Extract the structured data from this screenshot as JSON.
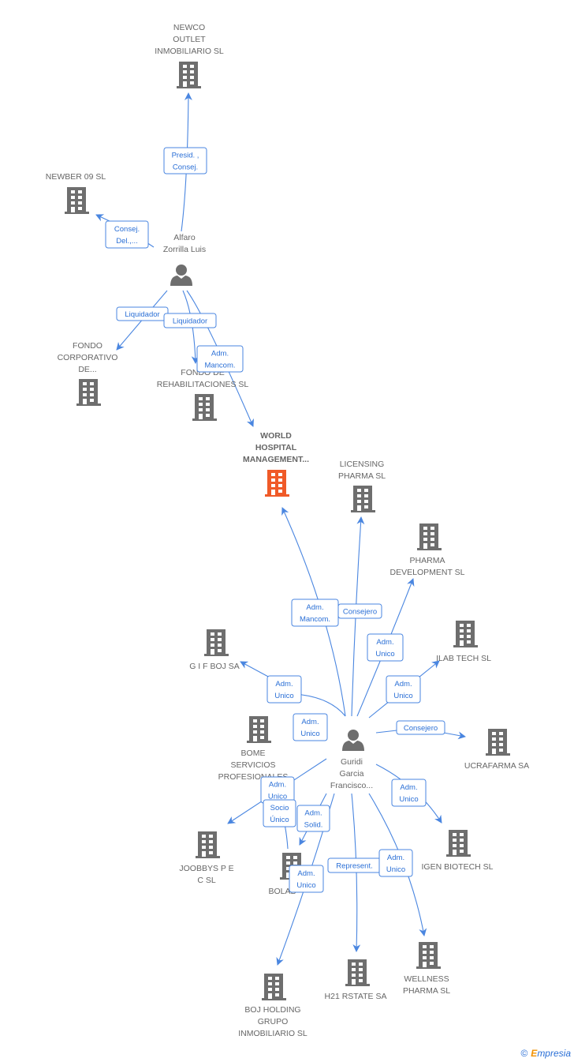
{
  "colors": {
    "edge": "#4a86e0",
    "company": "#6e6e6e",
    "focus_company": "#f05a28",
    "person": "#6e6e6e"
  },
  "nodes": [
    {
      "id": "newco",
      "type": "company",
      "lines": [
        "NEWCO",
        "OUTLET",
        "INMOBILIARIO SL"
      ]
    },
    {
      "id": "newber",
      "type": "company",
      "lines": [
        "NEWBER 09 SL"
      ]
    },
    {
      "id": "alfaro",
      "type": "person",
      "lines": [
        "Alfaro",
        "Zorrilla Luis"
      ]
    },
    {
      "id": "fondo_corp",
      "type": "company",
      "lines": [
        "FONDO",
        "CORPORATIVO",
        "DE..."
      ]
    },
    {
      "id": "fondo_rehab",
      "type": "company",
      "lines": [
        "FONDO DE",
        "REHABILITACIONES SL"
      ]
    },
    {
      "id": "world",
      "type": "focus",
      "lines": [
        "WORLD",
        "HOSPITAL",
        "MANAGEMENT..."
      ]
    },
    {
      "id": "licensing",
      "type": "company",
      "lines": [
        "LICENSING",
        "PHARMA SL"
      ]
    },
    {
      "id": "pharma_dev",
      "type": "company",
      "lines": [
        "PHARMA",
        "DEVELOPMENT SL"
      ]
    },
    {
      "id": "ilab",
      "type": "company",
      "lines": [
        "ILAB TECH SL"
      ]
    },
    {
      "id": "gif",
      "type": "company",
      "lines": [
        "G I F BOJ SA"
      ]
    },
    {
      "id": "ucrafarma",
      "type": "company",
      "lines": [
        "UCRAFARMA SA"
      ]
    },
    {
      "id": "guridi",
      "type": "person",
      "lines": [
        "Guridi",
        "Garcia",
        "Francisco..."
      ]
    },
    {
      "id": "bome",
      "type": "company",
      "lines": [
        "BOME",
        "SERVICIOS",
        "PROFESIONALES"
      ]
    },
    {
      "id": "joobbys",
      "type": "company",
      "lines": [
        "JOOBBYS P E",
        "C SL"
      ]
    },
    {
      "id": "bolab",
      "type": "company",
      "lines": [
        "BOLAB"
      ]
    },
    {
      "id": "igen",
      "type": "company",
      "lines": [
        "IGEN BIOTECH SL"
      ]
    },
    {
      "id": "h21",
      "type": "company",
      "lines": [
        "H21 RSTATE SA"
      ]
    },
    {
      "id": "wellness",
      "type": "company",
      "lines": [
        "WELLNESS",
        "PHARMA SL"
      ]
    },
    {
      "id": "boj_holding",
      "type": "company",
      "lines": [
        "BOJ HOLDING",
        "GRUPO",
        "INMOBILIARIO SL"
      ]
    }
  ],
  "edges": [
    {
      "from": "alfaro",
      "to": "newco",
      "label": [
        "Presid. ,",
        "Consej."
      ]
    },
    {
      "from": "alfaro",
      "to": "newber",
      "label": [
        "Consej.",
        "Del.,..."
      ]
    },
    {
      "from": "alfaro",
      "to": "fondo_corp",
      "label": [
        "Liquidador"
      ]
    },
    {
      "from": "alfaro",
      "to": "fondo_rehab",
      "label": [
        "Liquidador"
      ]
    },
    {
      "from": "alfaro",
      "to": "world",
      "label": [
        "Adm.",
        "Mancom."
      ]
    },
    {
      "from": "guridi",
      "to": "world",
      "label": [
        "Adm.",
        "Mancom."
      ]
    },
    {
      "from": "guridi",
      "to": "licensing",
      "label": [
        "Consejero"
      ]
    },
    {
      "from": "guridi",
      "to": "pharma_dev",
      "label": [
        "Adm.",
        "Unico"
      ]
    },
    {
      "from": "guridi",
      "to": "ilab",
      "label": [
        "Adm.",
        "Unico"
      ]
    },
    {
      "from": "guridi",
      "to": "gif",
      "label": [
        "Adm.",
        "Unico"
      ]
    },
    {
      "from": "guridi",
      "to": "bome",
      "label": [
        "Adm.",
        "Unico"
      ]
    },
    {
      "from": "guridi",
      "to": "ucrafarma",
      "label": [
        "Consejero"
      ]
    },
    {
      "from": "guridi",
      "to": "igen",
      "label": [
        "Adm.",
        "Unico"
      ]
    },
    {
      "from": "guridi",
      "to": "joobbys",
      "label": [
        "Adm.",
        "Unico"
      ]
    },
    {
      "from": "guridi",
      "to": "bome",
      "label": [
        "Socio",
        "Único"
      ]
    },
    {
      "from": "guridi",
      "to": "bolab",
      "label": [
        "Adm.",
        "Solid."
      ]
    },
    {
      "from": "guridi",
      "to": "boj_holding",
      "label": [
        "Adm.",
        "Unico"
      ]
    },
    {
      "from": "guridi",
      "to": "h21",
      "label": [
        "Represent."
      ]
    },
    {
      "from": "guridi",
      "to": "wellness",
      "label": [
        "Adm.",
        "Unico"
      ]
    }
  ],
  "footer": {
    "copyright": "©",
    "brand_initial": "E",
    "brand_rest": "mpresia"
  }
}
